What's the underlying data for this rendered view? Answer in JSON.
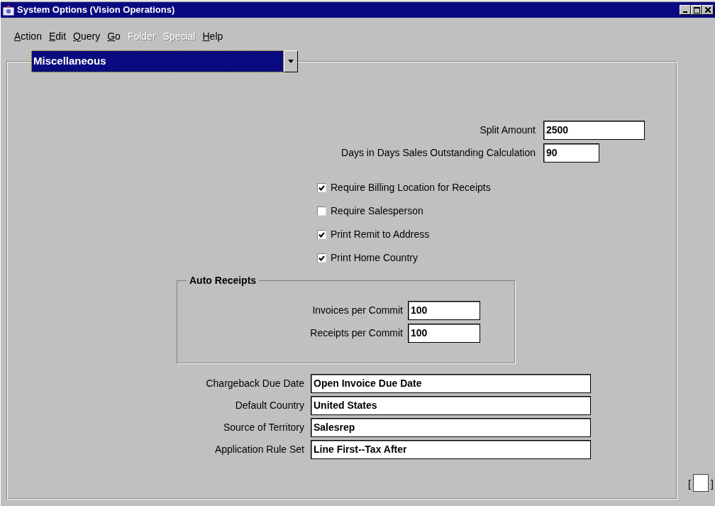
{
  "window": {
    "title": "System Options (Vision Operations)"
  },
  "menu": [
    {
      "label": "Action",
      "disabled": false
    },
    {
      "label": "Edit",
      "disabled": false
    },
    {
      "label": "Query",
      "disabled": false
    },
    {
      "label": "Go",
      "disabled": false
    },
    {
      "label": "Folder",
      "disabled": true
    },
    {
      "label": "Special",
      "disabled": true
    },
    {
      "label": "Help",
      "disabled": false
    }
  ],
  "region_select": {
    "value": "Miscellaneous"
  },
  "top_fields": [
    {
      "label": "Split Amount",
      "value": "2500"
    },
    {
      "label": "Days in Days Sales Outstanding Calculation",
      "value": "90"
    }
  ],
  "checkboxes": [
    {
      "label": "Require Billing Location for Receipts",
      "checked": true
    },
    {
      "label": "Require Salesperson",
      "checked": false
    },
    {
      "label": "Print Remit to Address",
      "checked": true
    },
    {
      "label": "Print Home Country",
      "checked": true
    }
  ],
  "auto_receipts": {
    "title": "Auto Receipts",
    "fields": [
      {
        "label": "Invoices per Commit",
        "value": "100"
      },
      {
        "label": "Receipts per Commit",
        "value": "100"
      }
    ]
  },
  "bottom_fields": [
    {
      "label": "Chargeback Due Date",
      "value": "Open Invoice Due Date"
    },
    {
      "label": "Default Country",
      "value": "United States"
    },
    {
      "label": "Source of Territory",
      "value": "Salesrep"
    },
    {
      "label": "Application Rule Set",
      "value": "Line First--Tax After"
    }
  ],
  "indicator": {
    "left": "[",
    "right": "]"
  }
}
